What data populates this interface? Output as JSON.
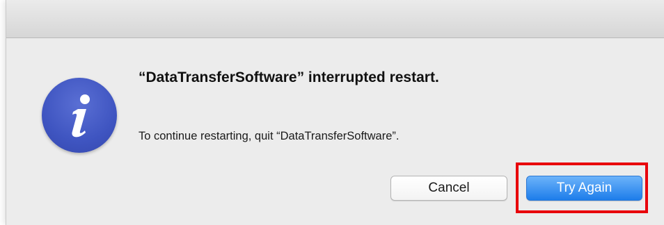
{
  "dialog": {
    "message": "“DataTransferSoftware” interrupted restart.",
    "informative_text": "To continue restarting, quit “DataTransferSoftware”.",
    "icon": "info-icon",
    "buttons": {
      "cancel_label": "Cancel",
      "try_again_label": "Try Again"
    }
  },
  "annotation": {
    "highlight_target": "try-again-button",
    "highlight_color": "#e8000b"
  },
  "colors": {
    "default_button": "#1d7dea",
    "icon_blue": "#3f55c1",
    "dialog_background": "#ececec"
  }
}
